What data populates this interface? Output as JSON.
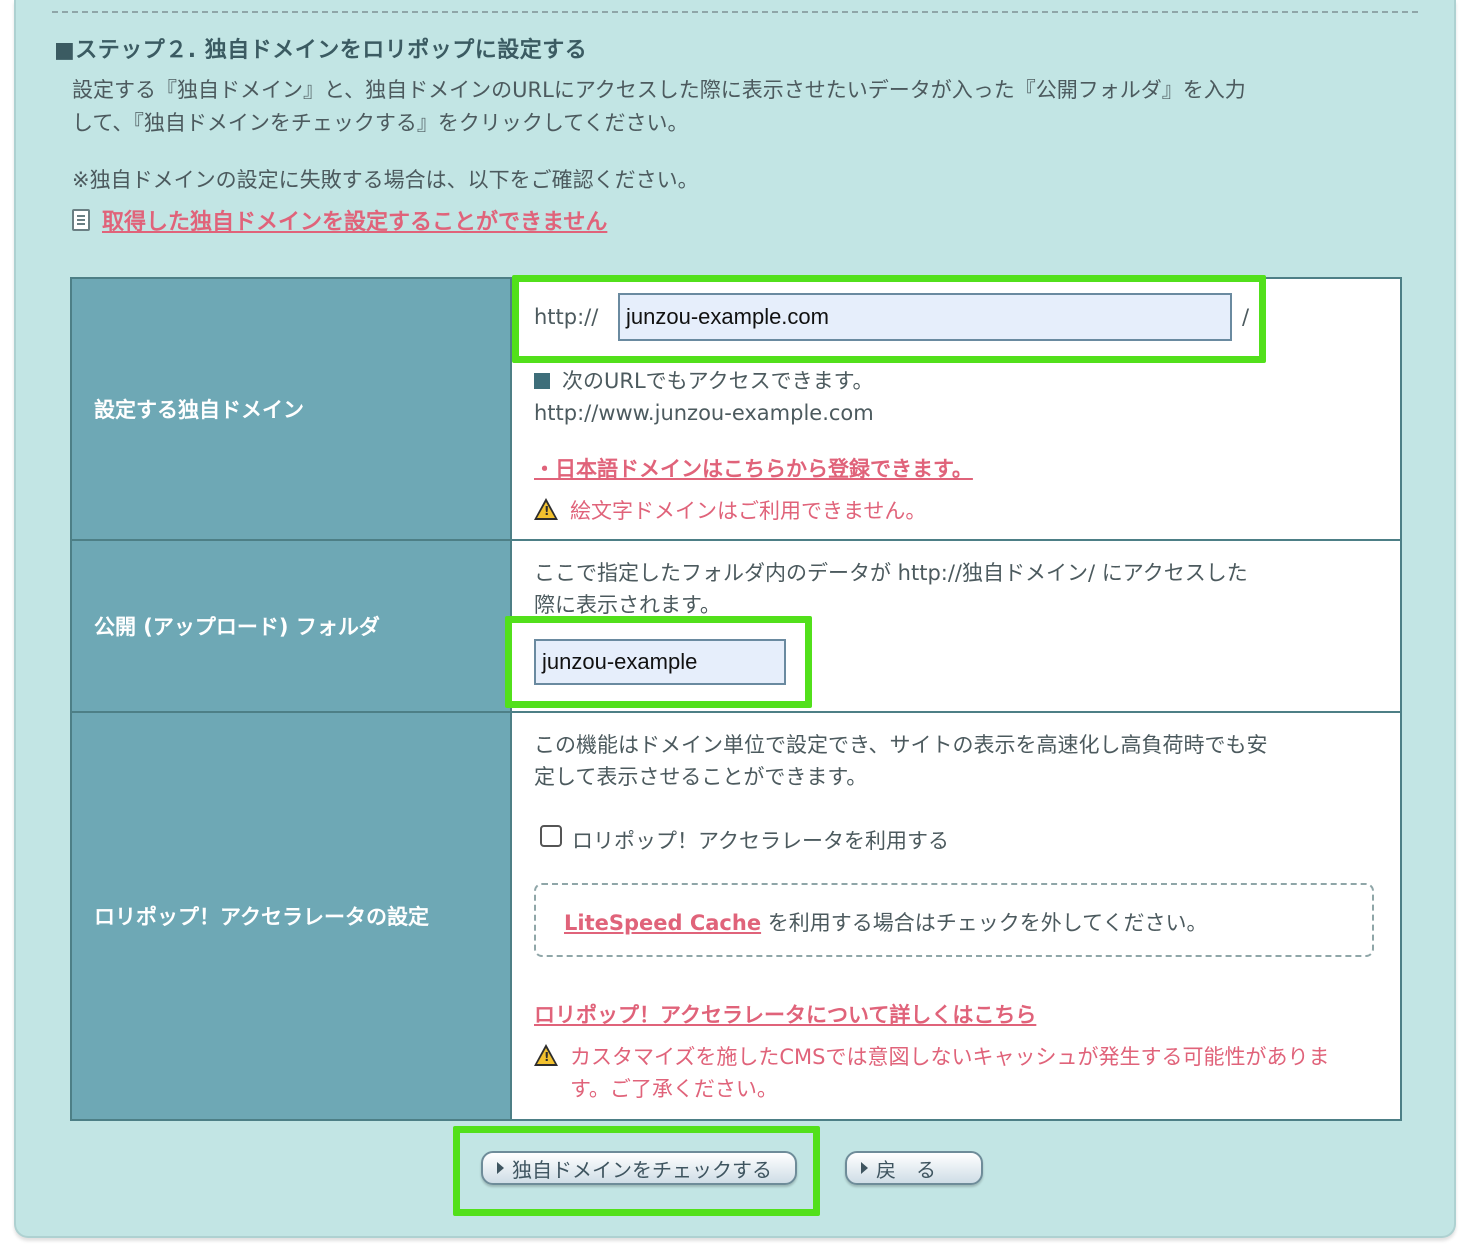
{
  "step": {
    "title": "■ステップ２. 独自ドメインをロリポップに設定する",
    "desc_line1": "設定する『独自ドメイン』と、独自ドメインのURLにアクセスした際に表示させたいデータが入った『公開フォルダ』を入力",
    "desc_line2": "して、『独自ドメインをチェックする』をクリックしてください。",
    "note": "※独自ドメインの設定に失敗する場合は、以下をご確認ください。",
    "help_link": "取得した独自ドメインを設定することができません"
  },
  "form": {
    "domain": {
      "label": "設定する独自ドメイン",
      "prefix": "http://",
      "value": "junzou-example.com",
      "suffix": "/",
      "www_note": "次のURLでもアクセスできます。",
      "www_url": "http://www.junzou-example.com",
      "jp_link": "・日本語ドメインはこちらから登録できます。",
      "emoji_warning": "絵文字ドメインはご利用できません。"
    },
    "folder": {
      "label": "公開 (アップロード) フォルダ",
      "desc_line1": "ここで指定したフォルダ内のデータが http://独自ドメイン/ にアクセスした",
      "desc_line2": "際に表示されます。",
      "value": "junzou-example"
    },
    "accelerator": {
      "label": "ロリポップ！アクセラレータの設定",
      "desc_line1": "この機能はドメイン単位で設定でき、サイトの表示を高速化し高負荷時でも安",
      "desc_line2": "定して表示させることができます。",
      "checkbox_label": "ロリポップ！アクセラレータを利用する",
      "checked": false,
      "litespeed_link": "LiteSpeed Cache",
      "litespeed_note": " を利用する場合はチェックを外してください。",
      "detail_link": "ロリポップ！アクセラレータについて詳しくはこちら",
      "warning_line1": "カスタマイズを施したCMSでは意図しないキャッシュが発生する可能性がありま",
      "warning_line2": "す。ご了承ください。"
    }
  },
  "buttons": {
    "check": "独自ドメインをチェックする",
    "back": "戻　る"
  },
  "colors": {
    "highlight": "#52e01b",
    "header_cell": "#6ea8b5",
    "panel_bg": "#c2e5e4",
    "link": "#e0637a"
  }
}
